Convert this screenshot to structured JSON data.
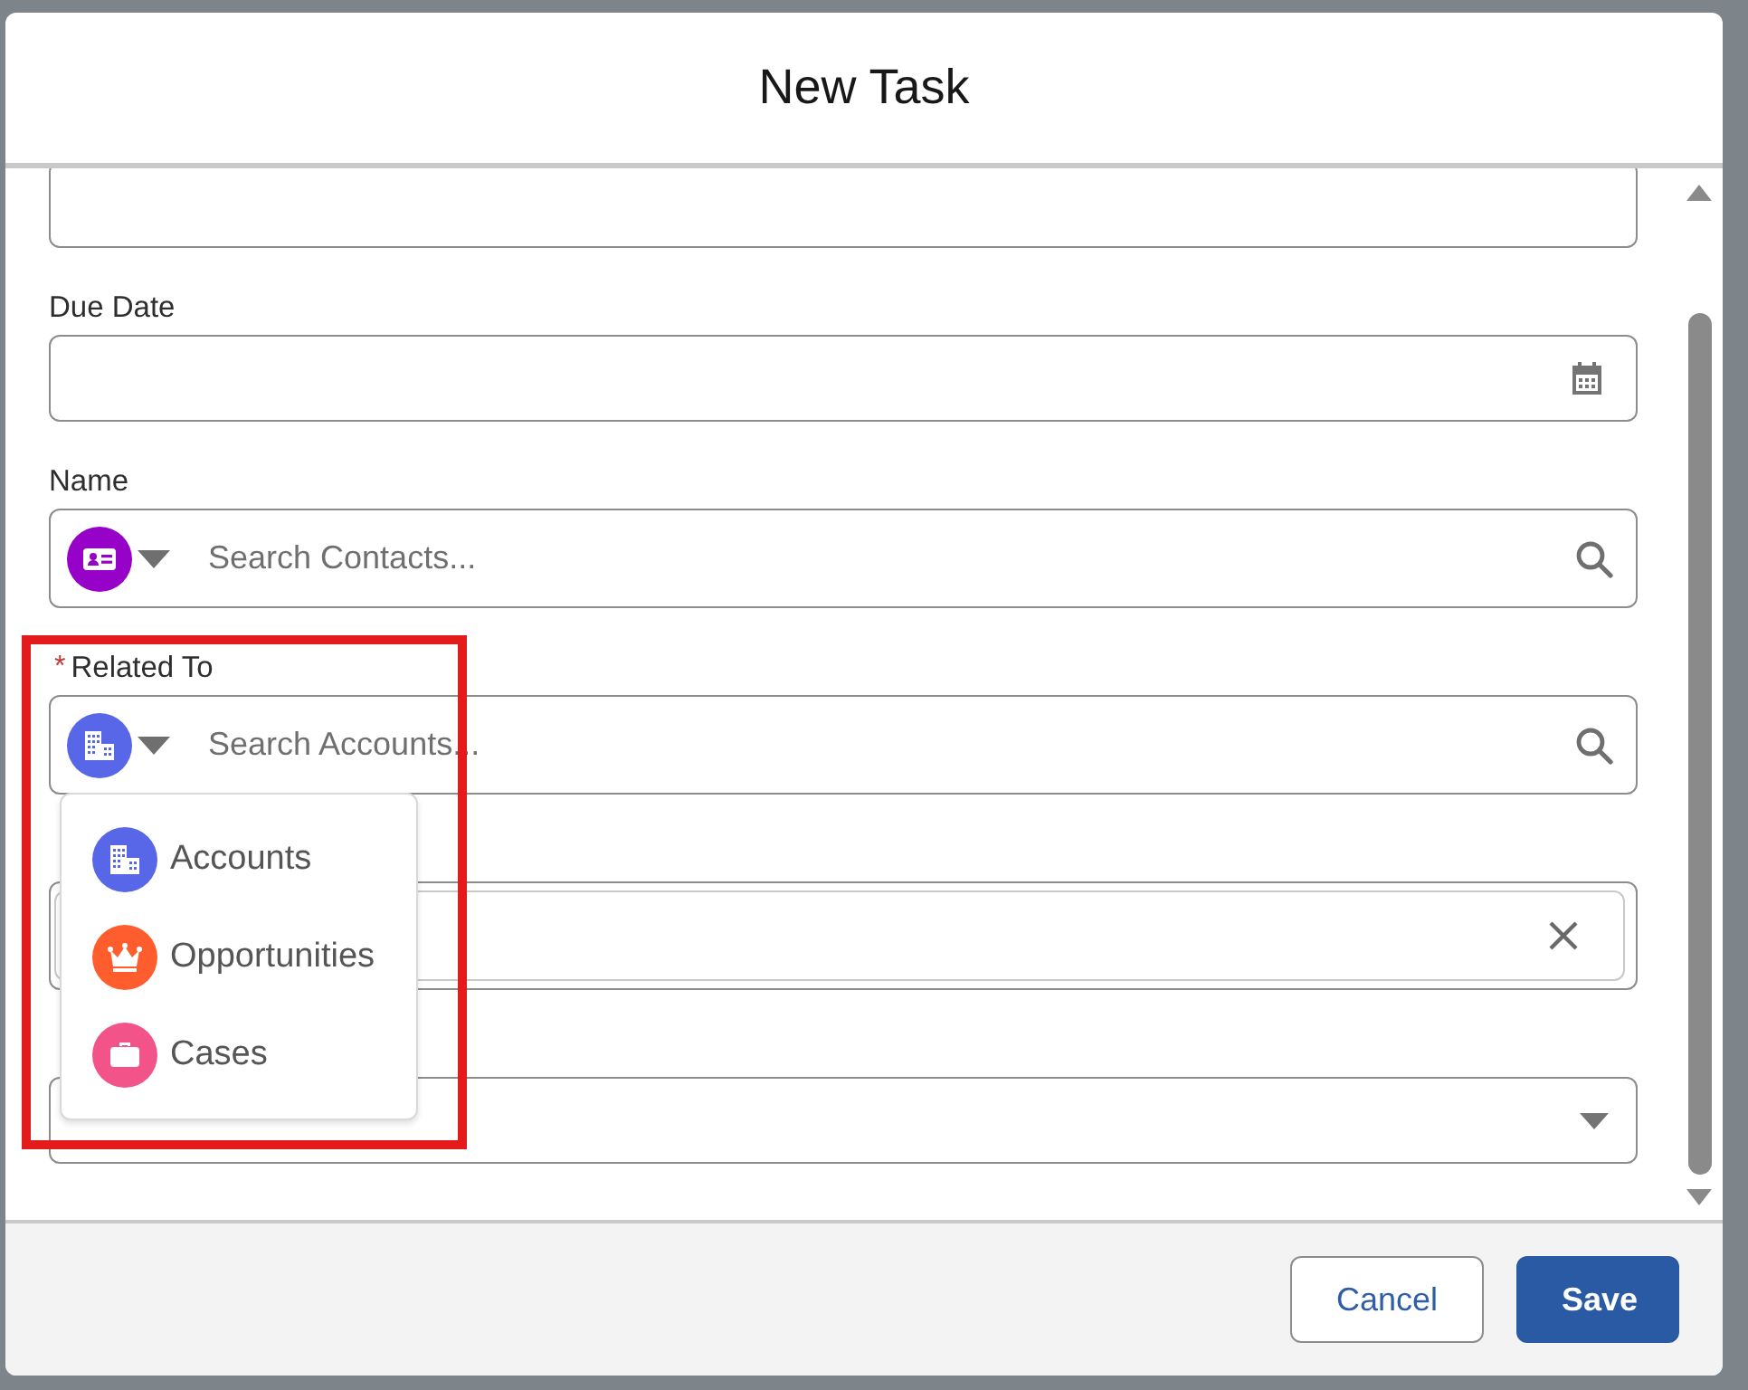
{
  "modal": {
    "title": "New Task"
  },
  "fields": [
    {
      "kind": "textarea"
    },
    {
      "kind": "date",
      "label": "Due Date"
    },
    {
      "kind": "contact-lookup",
      "label": "Name",
      "placeholder": "Search Contacts...",
      "color": "#9602c7"
    },
    {
      "kind": "account-lookup",
      "label": "Related To",
      "required_mark": "*",
      "placeholder": "Search Accounts...",
      "color": "#5867e8",
      "expanded": true,
      "options": [
        {
          "label": "Accounts",
          "kind": "account",
          "color": "#5867e8"
        },
        {
          "label": "Opportunities",
          "kind": "opportunity",
          "color": "#ff5d2d"
        },
        {
          "label": "Cases",
          "kind": "case",
          "color": "#f2548a"
        }
      ]
    },
    {
      "kind": "clearable"
    },
    {
      "kind": "select"
    }
  ],
  "buttons": [
    {
      "label": "Cancel",
      "kind": "neutral"
    },
    {
      "label": "Save",
      "kind": "brand"
    }
  ]
}
